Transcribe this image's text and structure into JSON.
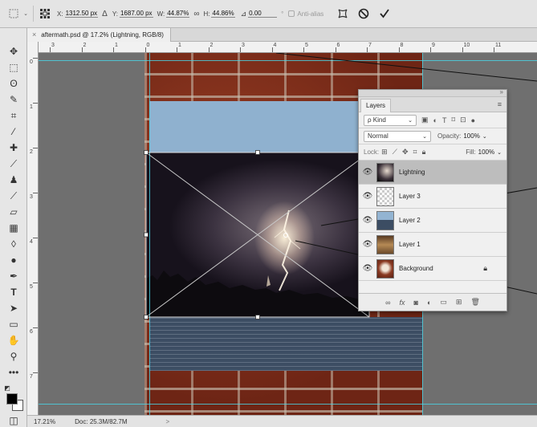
{
  "options_bar": {
    "x_label": "X:",
    "x_value": "1312.50 px",
    "delta_label": "Δ",
    "y_label": "Y:",
    "y_value": "1687.00 px",
    "w_label": "W:",
    "w_value": "44.87%",
    "link_symbol": "∞",
    "h_label": "H:",
    "h_value": "44.86%",
    "angle_symbol": "⊿",
    "angle_value": "0.00",
    "degree_symbol": "°",
    "antialias_label": "Anti-alias",
    "antialias_checked": false
  },
  "document_tab": {
    "close_symbol": "×",
    "title": "aftermath.psd @ 17.2% (Lightning, RGB/8)"
  },
  "rulers": {
    "horizontal": [
      "3",
      "2",
      "1",
      "0",
      "1",
      "2",
      "3",
      "4",
      "5",
      "6",
      "7",
      "8",
      "9",
      "10",
      "11"
    ],
    "vertical": [
      "0",
      "1",
      "2",
      "3",
      "4",
      "5",
      "6",
      "7",
      "8"
    ]
  },
  "status_bar": {
    "zoom": "17.21%",
    "doc_size": "Doc: 25.3M/82.7M",
    "arrow": ">"
  },
  "layers_panel": {
    "tab_label": "Layers",
    "filter_label": "ρ Kind",
    "blend_mode": "Normal",
    "opacity_label": "Opacity:",
    "opacity_value": "100%",
    "lock_label": "Lock:",
    "fill_label": "Fill:",
    "fill_value": "100%",
    "layers": [
      {
        "name": "Lightning",
        "visible": true,
        "selected": true,
        "locked": false
      },
      {
        "name": "Layer 3",
        "visible": true,
        "selected": false,
        "locked": false
      },
      {
        "name": "Layer 2",
        "visible": true,
        "selected": false,
        "locked": false
      },
      {
        "name": "Layer 1",
        "visible": true,
        "selected": false,
        "locked": false
      },
      {
        "name": "Background",
        "visible": true,
        "selected": false,
        "locked": true
      }
    ]
  },
  "colors": {
    "foreground": "#000000",
    "background": "#ffffff",
    "guide": "#4ad7e8",
    "panel_selected": "#bdbdbd"
  },
  "icons": {
    "options": [
      "move-tool-icon",
      "reference-point-icon",
      "warp-icon",
      "cancel-icon",
      "commit-checkmark-icon"
    ],
    "layer_footer": [
      "link-layers-icon",
      "fx-icon",
      "add-mask-icon",
      "adjustment-layer-icon",
      "new-group-icon",
      "new-layer-icon",
      "delete-layer-icon"
    ]
  }
}
